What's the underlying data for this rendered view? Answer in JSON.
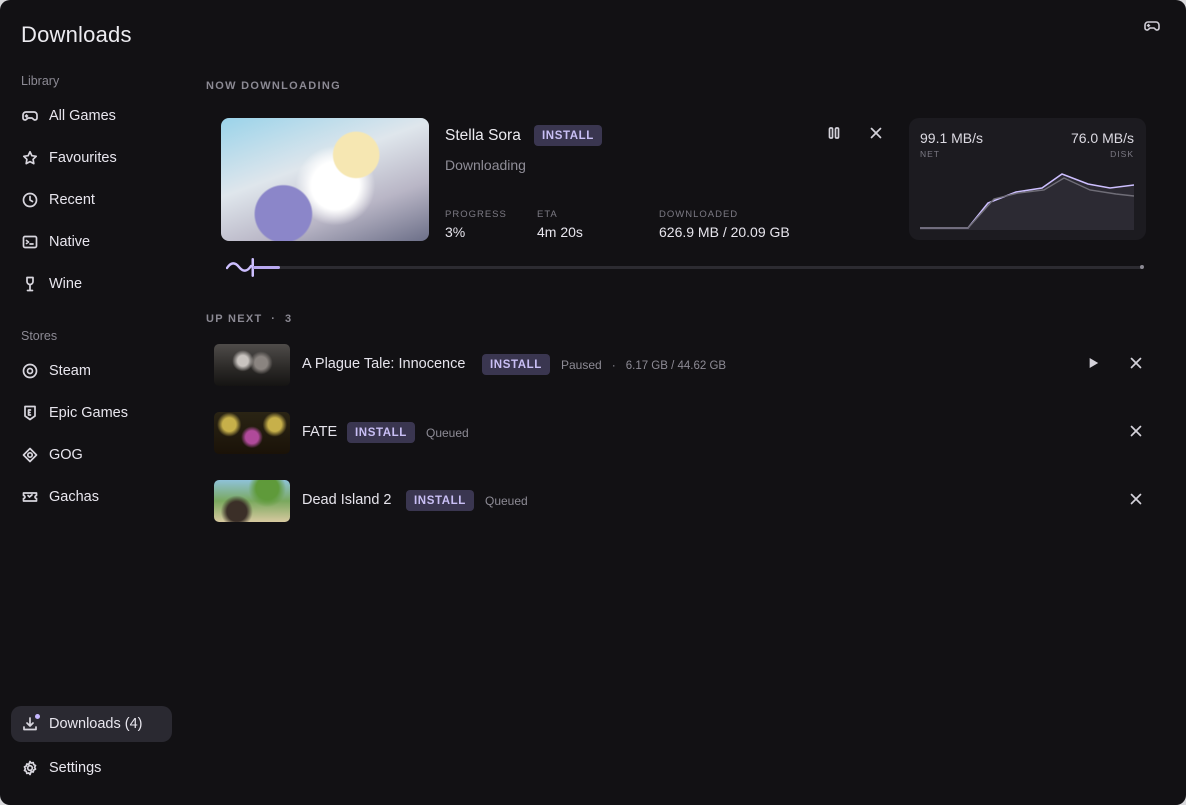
{
  "app": {
    "title": "Downloads"
  },
  "sidebar": {
    "library_label": "Library",
    "library": [
      {
        "label": "All Games",
        "icon": "gamepad-icon"
      },
      {
        "label": "Favourites",
        "icon": "star-icon"
      },
      {
        "label": "Recent",
        "icon": "clock-icon"
      },
      {
        "label": "Native",
        "icon": "terminal-icon"
      },
      {
        "label": "Wine",
        "icon": "wine-glass-icon"
      }
    ],
    "stores_label": "Stores",
    "stores": [
      {
        "label": "Steam",
        "icon": "steam-icon"
      },
      {
        "label": "Epic Games",
        "icon": "epic-shield-icon"
      },
      {
        "label": "GOG",
        "icon": "gog-icon"
      },
      {
        "label": "Gachas",
        "icon": "ticket-icon"
      }
    ],
    "downloads": {
      "label": "Downloads (4)",
      "icon": "download-icon"
    },
    "settings": {
      "label": "Settings",
      "icon": "gear-icon"
    }
  },
  "now_downloading": {
    "heading": "NOW DOWNLOADING",
    "game": "Stella Sora",
    "badge": "INSTALL",
    "status": "Downloading",
    "progress_label": "PROGRESS",
    "progress_value": "3%",
    "progress_fraction": 0.03,
    "eta_label": "ETA",
    "eta_value": "4m 20s",
    "downloaded_label": "DOWNLOADED",
    "downloaded_value": "626.9 MB / 20.09 GB",
    "net_speed": "99.1 MB/s",
    "net_label": "NET",
    "disk_speed": "76.0 MB/s",
    "disk_label": "DISK"
  },
  "up_next": {
    "heading": "UP NEXT",
    "count": "3",
    "items": [
      {
        "title": "A Plague Tale: Innocence",
        "badge": "INSTALL",
        "status": "Paused",
        "size": "6.17 GB / 44.62 GB"
      },
      {
        "title": "FATE",
        "badge": "INSTALL",
        "status": "Queued"
      },
      {
        "title": "Dead Island 2",
        "badge": "INSTALL",
        "status": "Queued"
      }
    ]
  },
  "colors": {
    "accent": "#b8a8f0",
    "background": "#121114",
    "card": "#1c1b20",
    "badge_bg": "#3a3650"
  }
}
